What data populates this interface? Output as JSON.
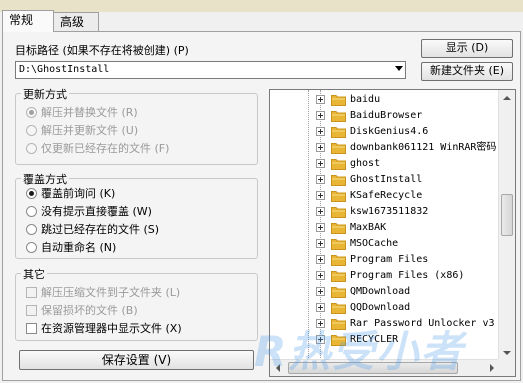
{
  "tabs": [
    {
      "label": "常规",
      "active": true
    },
    {
      "label": "高级",
      "active": false
    }
  ],
  "target_path": {
    "label": "目标路径 (如果不存在将被创建) (P)",
    "value": "D:\\GhostInstall",
    "show_button": "显示 (D)",
    "new_folder_button": "新建文件夹 (E)"
  },
  "update_mode": {
    "title": "更新方式",
    "options": [
      {
        "label": "解压并替换文件 (R)",
        "selected": true,
        "enabled": false
      },
      {
        "label": "解压并更新文件 (U)",
        "selected": false,
        "enabled": false
      },
      {
        "label": "仅更新已经存在的文件 (F)",
        "selected": false,
        "enabled": false
      }
    ]
  },
  "overwrite_mode": {
    "title": "覆盖方式",
    "options": [
      {
        "label": "覆盖前询问 (K)",
        "selected": true
      },
      {
        "label": "没有提示直接覆盖 (W)",
        "selected": false
      },
      {
        "label": "跳过已经存在的文件 (S)",
        "selected": false
      },
      {
        "label": "自动重命名 (N)",
        "selected": false
      }
    ]
  },
  "misc": {
    "title": "其它",
    "options": [
      {
        "label": "解压压缩文件到子文件夹 (L)",
        "checked": false,
        "enabled": false
      },
      {
        "label": "保留损坏的文件 (B)",
        "checked": false,
        "enabled": false
      },
      {
        "label": "在资源管理器中显示文件 (X)",
        "checked": false,
        "enabled": true
      }
    ]
  },
  "save_button": "保存设置 (V)",
  "folder_tree": {
    "items": [
      "baidu",
      "BaiduBrowser",
      "DiskGenius4.6",
      "downbank061121 WinRAR密码",
      "ghost",
      "GhostInstall",
      "KSafeRecycle",
      "ksw1673511832",
      "MaxBAK",
      "MSOCache",
      "Program Files",
      "Program Files (x86)",
      "QMDownload",
      "QQDownload",
      "Rar Password Unlocker v3",
      "RECYCLER"
    ],
    "selected": "GhostInstall",
    "scroll_fraction": 0.45
  },
  "watermark": "R热受小者",
  "colors": {
    "folder": "#e8b634",
    "folder_dark": "#c8941a",
    "panel_bg": "#f4f4f4"
  }
}
